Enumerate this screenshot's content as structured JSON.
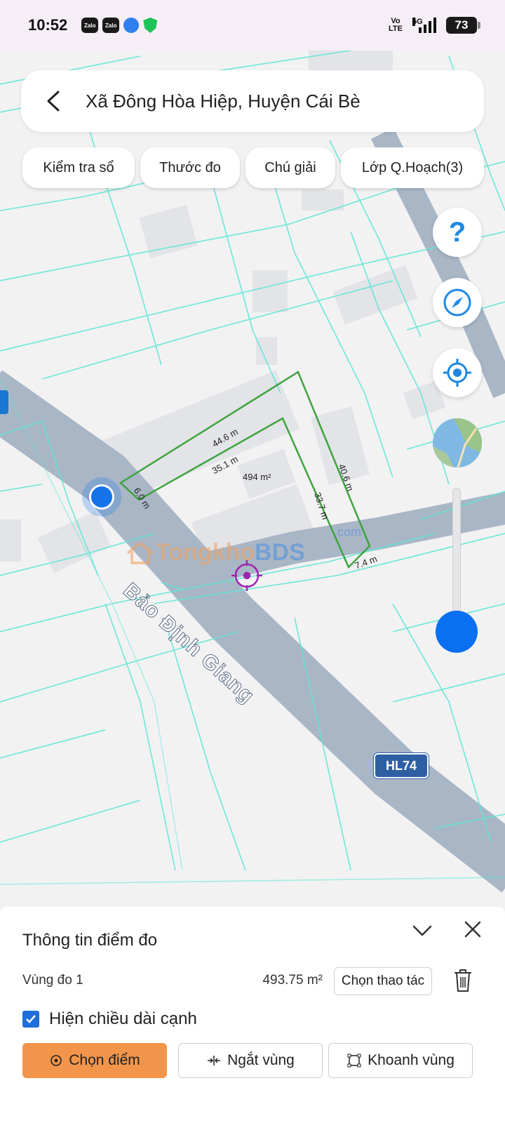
{
  "status_bar": {
    "time": "10:52",
    "notification_icons": [
      "zalo-icon",
      "zalo-icon",
      "browser-icon",
      "security-shield-icon"
    ],
    "volte": "Vo\nLTE",
    "network": "5G",
    "battery": "73"
  },
  "header": {
    "back_icon": "chevron-left-icon",
    "title": "Xã Đông Hòa Hiệp, Huyện Cái Bè"
  },
  "chips": [
    {
      "label": "Kiểm tra sổ"
    },
    {
      "label": "Thước đo"
    },
    {
      "label": "Chú giải"
    },
    {
      "label": "Lớp Q.Hoạch(3)"
    }
  ],
  "map_controls": {
    "help": "?",
    "icons": [
      "help-icon",
      "compass-icon",
      "my-location-icon",
      "satellite-layer-icon"
    ],
    "zoom_level": 0.1
  },
  "map": {
    "road_name": "Bảo Định Giang",
    "route_badge": "HL74",
    "parcel_area": "494 m²",
    "edges": {
      "top_outer": "44.6 m",
      "top_inner": "35.1 m",
      "left": "6.0 m",
      "right_outer": "40.6 m",
      "right_inner": "33.7 m",
      "bottom": "7.4 m"
    },
    "watermark": {
      "brand_a": "Tongkho",
      "brand_b": "BDS",
      "suffix": ".com"
    },
    "accent_color": "#1672e8",
    "parcel_color": "#3fa33f",
    "marker_color": "#9c27b0"
  },
  "panel": {
    "title": "Thông tin điểm đo",
    "area_name": "Vùng đo 1",
    "area_value": "493.75 m²",
    "action_label": "Chọn thao tác",
    "show_lengths_label": "Hiện chiều dài cạnh",
    "show_lengths_checked": true,
    "buttons": {
      "pick_point": "Chọn điểm",
      "break_area": "Ngắt vùng",
      "enclose_area": "Khoanh vùng"
    },
    "primary_color": "#f2954a"
  }
}
